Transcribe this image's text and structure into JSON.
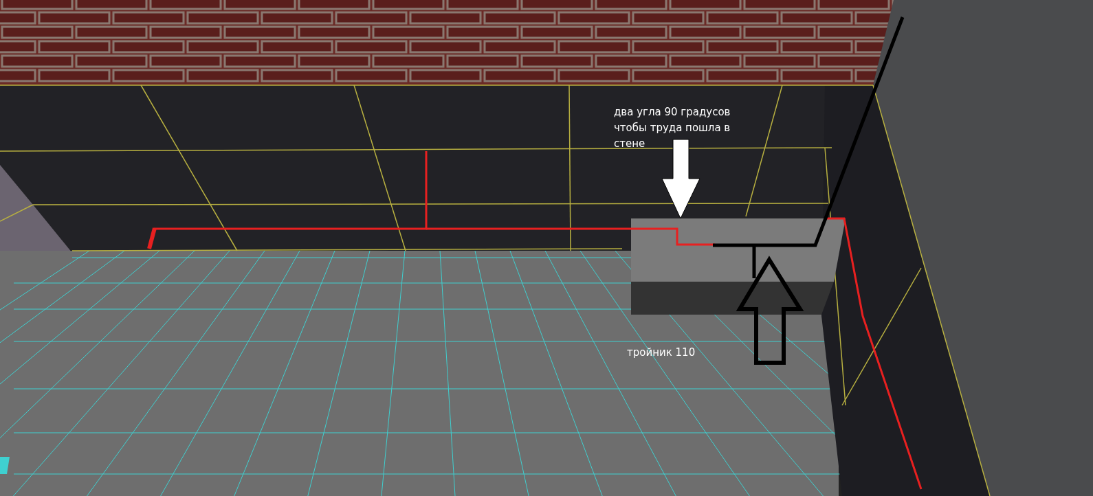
{
  "annotations": [
    {
      "kind": "note",
      "lines": [
        "два угла 90 градусов",
        "чтобы труда пошла в",
        "стене"
      ]
    },
    {
      "kind": "note",
      "lines": [
        "тройник 110"
      ]
    }
  ]
}
